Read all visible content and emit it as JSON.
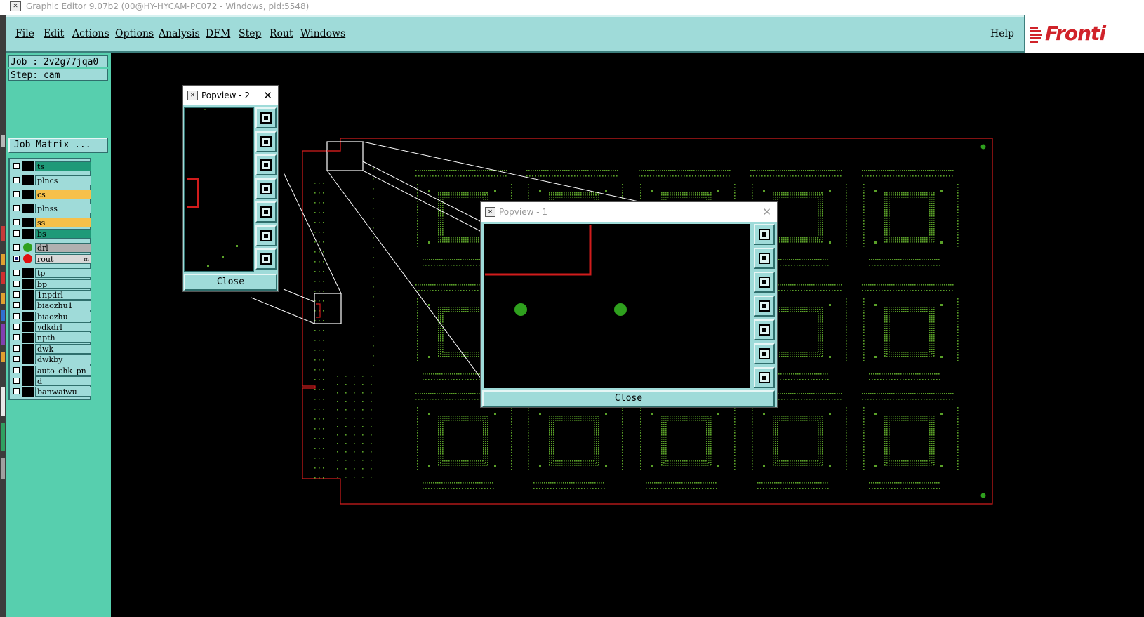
{
  "window": {
    "title": "Graphic Editor 9.07b2 (00@HY-HYCAM-PC072 - Windows, pid:5548)"
  },
  "menubar": {
    "items": [
      "File",
      "Edit",
      "Actions",
      "Options",
      "Analysis",
      "DFM",
      "Step",
      "Rout",
      "Windows"
    ],
    "help": "Help",
    "logo_text": "Fronti"
  },
  "job": {
    "job_label": "Job : 2v2g77jqa0",
    "step_label": "Step: cam",
    "matrix_button": "Job Matrix ..."
  },
  "layers": [
    {
      "name": "ts",
      "color": "#1f9a78",
      "checked": false,
      "indicator": "block"
    },
    {
      "name": "plncs",
      "color": "#9fdbd9",
      "checked": false,
      "indicator": "block"
    },
    {
      "name": "cs",
      "color": "#f6c04a",
      "checked": false,
      "indicator": "block"
    },
    {
      "name": "plnss",
      "color": "#9fdbd9",
      "checked": false,
      "indicator": "block"
    },
    {
      "name": "ss",
      "color": "#f6c04a",
      "checked": false,
      "indicator": "block"
    },
    {
      "name": "bs",
      "color": "#1f9a78",
      "checked": false,
      "indicator": "block"
    },
    {
      "name": "drl",
      "color": "#b0b0b0",
      "checked": false,
      "indicator": "dot",
      "dot_color": "#2fa01e"
    },
    {
      "name": "rout",
      "color": "#d8d8d8",
      "checked": true,
      "indicator": "dot",
      "dot_color": "#e01010",
      "mark": "m"
    },
    {
      "name": "tp",
      "color": "#9fdbd9",
      "checked": false,
      "indicator": "block"
    },
    {
      "name": "bp",
      "color": "#9fdbd9",
      "checked": false,
      "indicator": "block"
    },
    {
      "name": "1npdrl",
      "color": "#9fdbd9",
      "checked": false,
      "indicator": "block"
    },
    {
      "name": "biaozhu1",
      "color": "#9fdbd9",
      "checked": false,
      "indicator": "block"
    },
    {
      "name": "biaozhu",
      "color": "#9fdbd9",
      "checked": false,
      "indicator": "block"
    },
    {
      "name": "ydkdrl",
      "color": "#9fdbd9",
      "checked": false,
      "indicator": "block"
    },
    {
      "name": "npth",
      "color": "#9fdbd9",
      "checked": false,
      "indicator": "block"
    },
    {
      "name": "dwk",
      "color": "#9fdbd9",
      "checked": false,
      "indicator": "block"
    },
    {
      "name": "dwkby",
      "color": "#9fdbd9",
      "checked": false,
      "indicator": "block"
    },
    {
      "name": "auto_chk_pn",
      "color": "#9fdbd9",
      "checked": false,
      "indicator": "block"
    },
    {
      "name": "d",
      "color": "#9fdbd9",
      "checked": false,
      "indicator": "block"
    },
    {
      "name": "banwaiwu",
      "color": "#9fdbd9",
      "checked": false,
      "indicator": "block"
    }
  ],
  "popview2": {
    "title": "Popview - 2",
    "close_icon": "close-x-icon",
    "close_button": "Close"
  },
  "popview1": {
    "title": "Popview - 1",
    "close_icon": "close-x-icon",
    "close_button": "Close"
  },
  "popview_tools": [
    "zoom-home-icon",
    "pan-up-icon",
    "pan-down-icon",
    "pan-left-icon",
    "pan-right-icon",
    "zoom-in-icon",
    "zoom-out-icon"
  ],
  "colors": {
    "panel": "#57cfae",
    "menubar": "#9fdbd9",
    "board_outline": "#d11c1c",
    "pads": "#5aa028",
    "canvas": "#000000",
    "brand": "#d0232a"
  }
}
